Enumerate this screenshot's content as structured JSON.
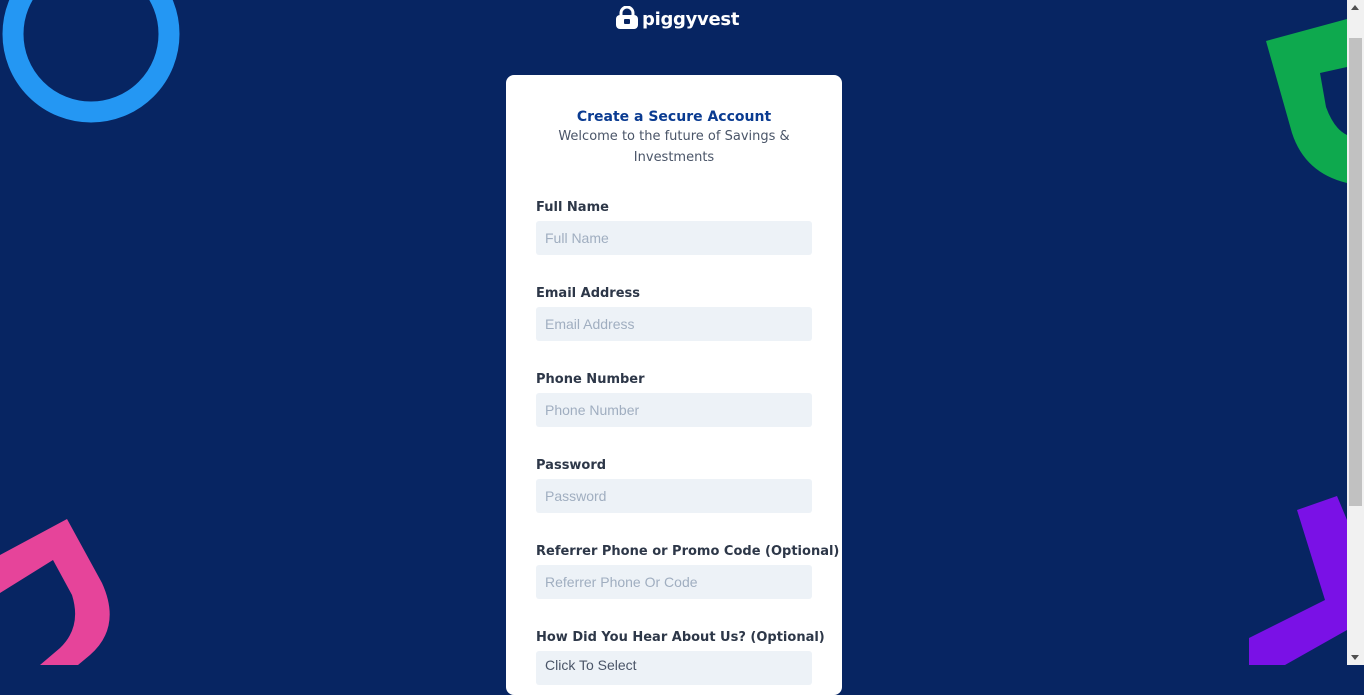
{
  "brand": {
    "name": "piggyvest"
  },
  "form": {
    "title": "Create a Secure Account",
    "subtitle": "Welcome to the future of Savings & Investments",
    "full_name": {
      "label": "Full Name",
      "placeholder": "Full Name"
    },
    "email": {
      "label": "Email Address",
      "placeholder": "Email Address"
    },
    "phone": {
      "label": "Phone Number",
      "placeholder": "Phone Number"
    },
    "password": {
      "label": "Password",
      "placeholder": "Password"
    },
    "referrer": {
      "label": "Referrer Phone or Promo Code (Optional)",
      "placeholder": "Referrer Phone Or Code"
    },
    "hear_about": {
      "label": "How Did You Hear About Us? (Optional)",
      "value": "Click To Select"
    }
  },
  "colors": {
    "background": "#072562",
    "title": "#0a3b91",
    "input_background": "#edf2f7",
    "deco_blue": "#2497f3",
    "deco_green": "#0ea94e",
    "deco_pink": "#e6449a",
    "deco_purple": "#7a11e6"
  },
  "icons": {
    "logo": "piggy-lock-icon"
  }
}
